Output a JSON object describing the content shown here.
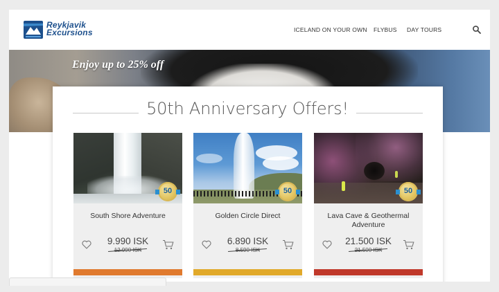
{
  "header": {
    "logo": {
      "line1": "Reykjavik",
      "line2": "Excursions"
    },
    "nav": [
      {
        "label": "ICELAND ON YOUR OWN"
      },
      {
        "label": "FLYBUS"
      },
      {
        "label": "DAY TOURS"
      }
    ],
    "search_icon": "search-icon"
  },
  "hero": {
    "tagline": "Enjoy up to 25% off"
  },
  "offers": {
    "title": "50th Anniversary Offers!",
    "badge": "50",
    "cards": [
      {
        "name": "South Shore Adventure",
        "price": "9.990 ISK",
        "old_price": "12.990 ISK",
        "bar_color": "#e07a2e"
      },
      {
        "name": "Golden Circle Direct",
        "price": "6.890 ISK",
        "old_price": "8.590 ISK",
        "bar_color": "#e1a92a"
      },
      {
        "name": "Lava Cave & Geothermal Adventure",
        "price": "21.500 ISK",
        "old_price": "21.500 ISK",
        "bar_color": "#c0392b"
      }
    ]
  },
  "colors": {
    "brand_blue": "#1c4f8c",
    "badge_gold": "#e2c562"
  }
}
